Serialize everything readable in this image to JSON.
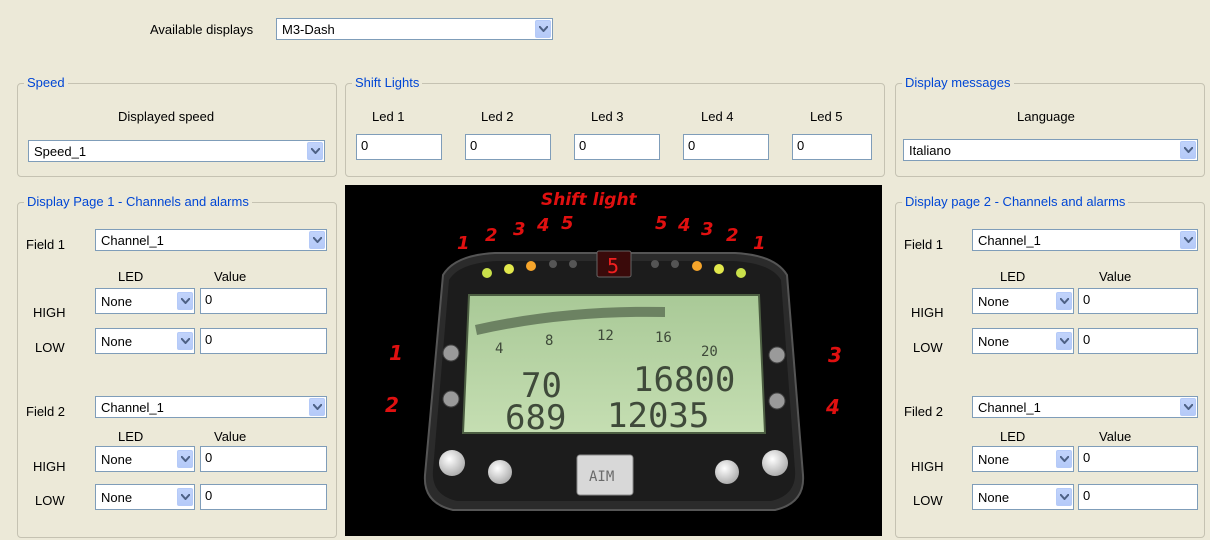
{
  "top": {
    "available_label": "Available displays",
    "available_value": "M3-Dash"
  },
  "speed": {
    "title": "Speed",
    "subtitle": "Displayed speed",
    "value": "Speed_1"
  },
  "shift": {
    "title": "Shift Lights",
    "leds": [
      {
        "label": "Led 1",
        "value": "0"
      },
      {
        "label": "Led 2",
        "value": "0"
      },
      {
        "label": "Led 3",
        "value": "0"
      },
      {
        "label": "Led 4",
        "value": "0"
      },
      {
        "label": "Led 5",
        "value": "0"
      }
    ]
  },
  "messages": {
    "title": "Display messages",
    "subtitle": "Language",
    "value": "Italiano"
  },
  "page1": {
    "title": "Display Page 1 - Channels and alarms",
    "fields": [
      {
        "label": "Field 1",
        "channel": "Channel_1",
        "led_header": "LED",
        "value_header": "Value",
        "high_label": "HIGH",
        "high_led": "None",
        "high_value": "0",
        "low_label": "LOW",
        "low_led": "None",
        "low_value": "0"
      },
      {
        "label": "Field 2",
        "channel": "Channel_1",
        "led_header": "LED",
        "value_header": "Value",
        "high_label": "HIGH",
        "high_led": "None",
        "high_value": "0",
        "low_label": "LOW",
        "low_led": "None",
        "low_value": "0"
      }
    ]
  },
  "page2": {
    "title": "Display page 2 - Channels and alarms",
    "fields": [
      {
        "label": "Field 1",
        "channel": "Channel_1",
        "led_header": "LED",
        "value_header": "Value",
        "high_label": "HIGH",
        "high_led": "None",
        "high_value": "0",
        "low_label": "LOW",
        "low_led": "None",
        "low_value": "0"
      },
      {
        "label": "Filed 2",
        "channel": "Channel_1",
        "led_header": "LED",
        "value_header": "Value",
        "high_label": "HIGH",
        "high_led": "None",
        "high_value": "0",
        "low_label": "LOW",
        "low_led": "None",
        "low_value": "0"
      }
    ]
  },
  "dash": {
    "shift_title": "Shift light",
    "left_nums": [
      "1",
      "2",
      "3",
      "4",
      "5"
    ],
    "right_nums": [
      "5",
      "4",
      "3",
      "2",
      "1"
    ],
    "gear": "5",
    "side_left": [
      "1",
      "2"
    ],
    "side_right": [
      "3",
      "4"
    ],
    "scale": [
      "4",
      "8",
      "12",
      "16",
      "20"
    ],
    "lcd_row1_left": "70",
    "lcd_row1_right": "16800",
    "lcd_row2_left": "689",
    "lcd_row2_right": "12035",
    "logo": "AIM"
  },
  "colors": {
    "title_blue": "#0046D5",
    "window_bg": "#ECE9D8",
    "marker_red": "#E01010",
    "lcd_green": "#B9D7A4"
  }
}
